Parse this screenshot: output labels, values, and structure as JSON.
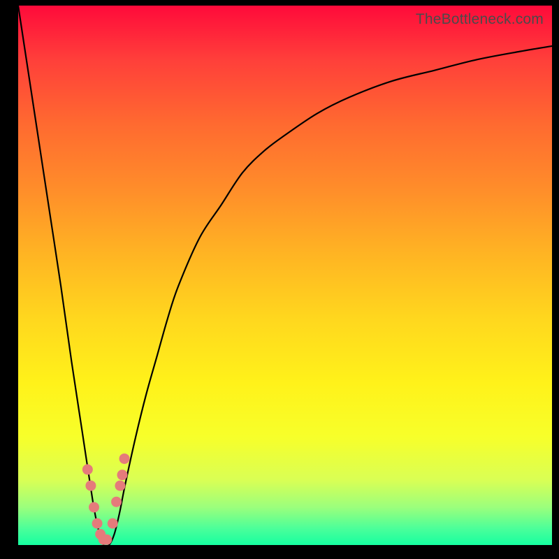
{
  "watermark": {
    "text": "TheBottleneck.com"
  },
  "chart_data": {
    "type": "line",
    "title": "",
    "xlabel": "",
    "ylabel": "",
    "xlim": [
      0,
      100
    ],
    "ylim": [
      0,
      100
    ],
    "grid": false,
    "legend": false,
    "series": [
      {
        "name": "bottleneck-curve",
        "x": [
          0,
          2,
          4,
          6,
          8,
          10,
          12,
          14,
          15,
          16,
          17,
          18,
          19,
          20,
          22,
          24,
          26,
          28,
          30,
          34,
          38,
          42,
          46,
          50,
          56,
          62,
          70,
          78,
          86,
          94,
          100
        ],
        "values": [
          100,
          87,
          74,
          61,
          48,
          34,
          21,
          8,
          3,
          0,
          0,
          2,
          6,
          11,
          20,
          28,
          35,
          42,
          48,
          57,
          63,
          69,
          73,
          76,
          80,
          83,
          86,
          88,
          90,
          91.5,
          92.5
        ]
      }
    ],
    "markers": {
      "name": "highlight-dots",
      "color": "#e57b7b",
      "x": [
        13.0,
        13.6,
        14.2,
        14.8,
        15.4,
        16.0,
        16.6,
        17.7,
        18.4,
        19.1,
        19.5,
        19.9
      ],
      "y": [
        14,
        11,
        7,
        4,
        2,
        1,
        1,
        4,
        8,
        11,
        13,
        16
      ]
    },
    "background": {
      "type": "vertical-gradient",
      "top_color": "#ff0a3a",
      "bottom_color": "#16ffa0"
    }
  }
}
